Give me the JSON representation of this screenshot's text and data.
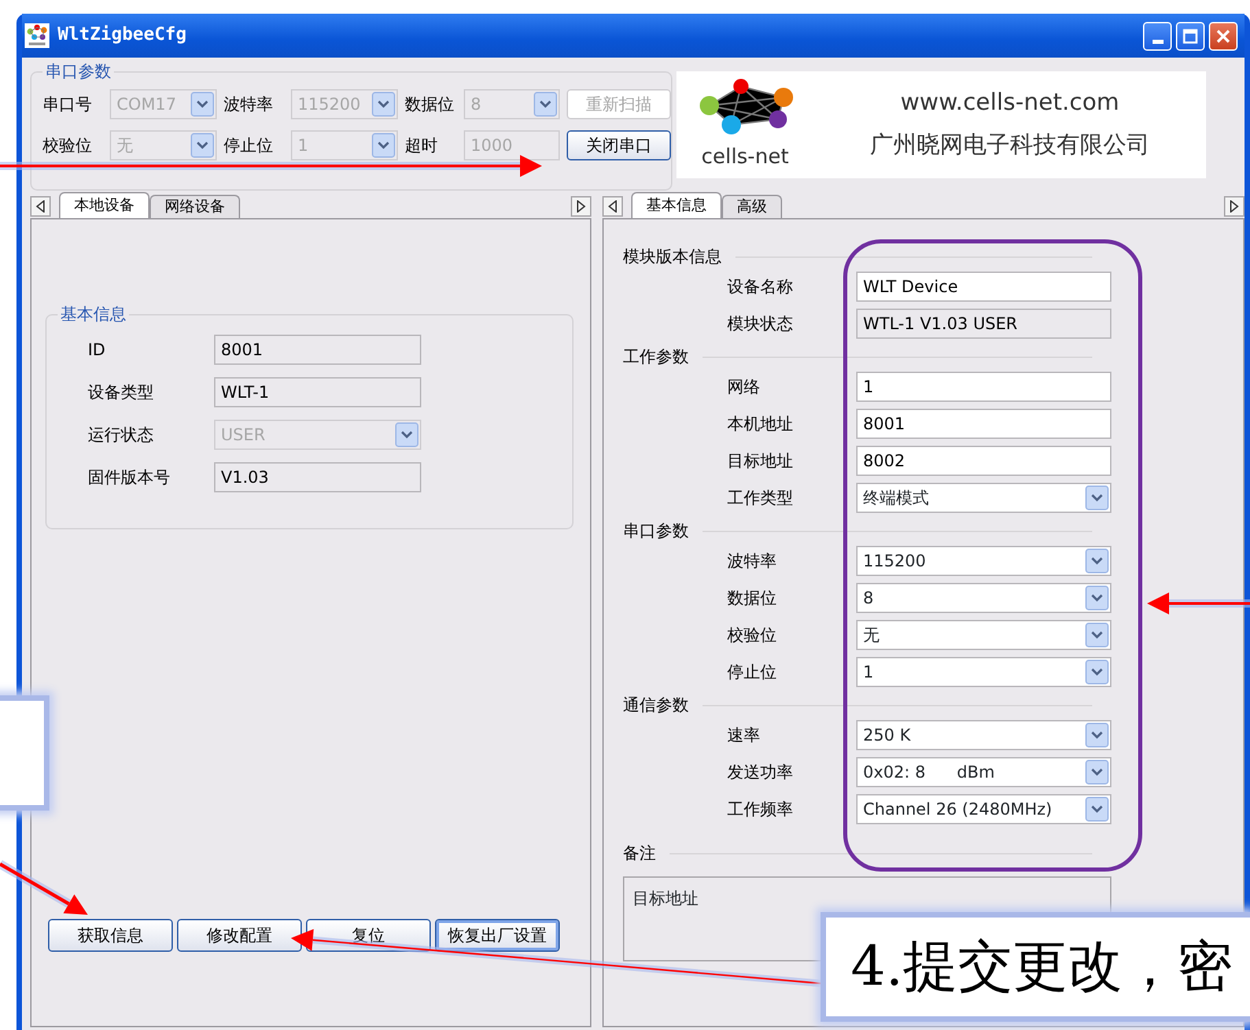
{
  "window": {
    "title": "WltZigbeeCfg"
  },
  "serial_group": {
    "title": "串口参数",
    "fields": [
      {
        "label": "串口号",
        "value": "COM17",
        "kind": "combo",
        "disabled": true
      },
      {
        "label": "波特率",
        "value": "115200",
        "kind": "combo",
        "disabled": true
      },
      {
        "label": "数据位",
        "value": "8",
        "kind": "combo",
        "disabled": true
      },
      {
        "label": "校验位",
        "value": "无",
        "kind": "combo",
        "disabled": true
      },
      {
        "label": "停止位",
        "value": "1",
        "kind": "combo",
        "disabled": true
      },
      {
        "label": "超时",
        "value": "1000",
        "kind": "text",
        "disabled": true
      }
    ],
    "buttons": [
      {
        "label": "重新扫描",
        "disabled": true
      },
      {
        "label": "关闭串口",
        "disabled": false
      }
    ]
  },
  "logo": {
    "brand": "cells-net",
    "url": "www.cells-net.com",
    "company": "广州晓网电子科技有限公司"
  },
  "left_panel": {
    "tabs": [
      {
        "label": "本地设备",
        "selected": true
      },
      {
        "label": "网络设备",
        "selected": false
      }
    ],
    "group": {
      "title": "基本信息",
      "fields": [
        {
          "label": "ID",
          "value": "8001",
          "kind": "readonly",
          "disabled": false
        },
        {
          "label": "设备类型",
          "value": "WLT-1",
          "kind": "readonly",
          "disabled": false
        },
        {
          "label": "运行状态",
          "value": "USER",
          "kind": "combo",
          "disabled": true
        },
        {
          "label": "固件版本号",
          "value": "V1.03",
          "kind": "readonly",
          "disabled": false
        }
      ]
    },
    "buttons": [
      {
        "label": "获取信息",
        "focused": false
      },
      {
        "label": "修改配置",
        "focused": false
      },
      {
        "label": "复位",
        "focused": false
      },
      {
        "label": "恢复出厂设置",
        "focused": true
      }
    ]
  },
  "right_panel": {
    "tabs": [
      {
        "label": "基本信息",
        "selected": true
      },
      {
        "label": "高级",
        "selected": false
      }
    ],
    "sections": [
      {
        "title": "模块版本信息",
        "fields": [
          {
            "label": "设备名称",
            "value": "WLT Device",
            "kind": "text"
          },
          {
            "label": "模块状态",
            "value": "WTL-1 V1.03 USER",
            "kind": "readonly"
          }
        ]
      },
      {
        "title": "工作参数",
        "fields": [
          {
            "label": "网络",
            "value": "1",
            "kind": "text"
          },
          {
            "label": "本机地址",
            "value": "8001",
            "kind": "text"
          },
          {
            "label": "目标地址",
            "value": "8002",
            "kind": "text"
          },
          {
            "label": "工作类型",
            "value": "终端模式",
            "kind": "combo"
          }
        ]
      },
      {
        "title": "串口参数",
        "fields": [
          {
            "label": "波特率",
            "value": "115200",
            "kind": "combo"
          },
          {
            "label": "数据位",
            "value": "8",
            "kind": "combo"
          },
          {
            "label": "校验位",
            "value": "无",
            "kind": "combo"
          },
          {
            "label": "停止位",
            "value": "1",
            "kind": "combo"
          }
        ]
      },
      {
        "title": "通信参数",
        "fields": [
          {
            "label": "速率",
            "value": "250 K",
            "kind": "combo"
          },
          {
            "label": "发送功率",
            "value": "0x02: 8      dBm",
            "kind": "combo"
          },
          {
            "label": "工作频率",
            "value": "Channel 26 (2480MHz)",
            "kind": "combo"
          }
        ]
      }
    ],
    "notes": {
      "title": "备注",
      "value": "目标地址"
    }
  },
  "callouts": [
    {
      "kind": "blank"
    },
    {
      "kind": "text",
      "text": "4.提交更改，密"
    }
  ]
}
